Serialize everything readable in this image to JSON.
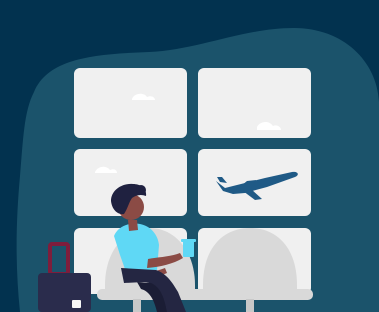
{
  "colors": {
    "background": "#02324f",
    "blob": "#1b536b",
    "window_panel": "#f0f0f0",
    "cloud": "#ffffff",
    "airplane": "#1f5a86",
    "seat": "#d9d9d9",
    "seat_shadow": "#c8c8c8",
    "shirt": "#5fd8f5",
    "skin": "#8b4b45",
    "hair": "#1f2140",
    "pants": "#242642",
    "cup": "#5fd8f5",
    "suitcase": "#2a2c4c",
    "suitcase_handle": "#7e1d3c",
    "suitcase_accent": "#f7f7f7"
  },
  "icons": {
    "airplane": "airplane-icon",
    "cloud": "cloud-icon",
    "suitcase": "suitcase-icon"
  },
  "scene": {
    "window_count": 6,
    "seat_count": 2,
    "figure": "seated-traveler-with-cup"
  }
}
